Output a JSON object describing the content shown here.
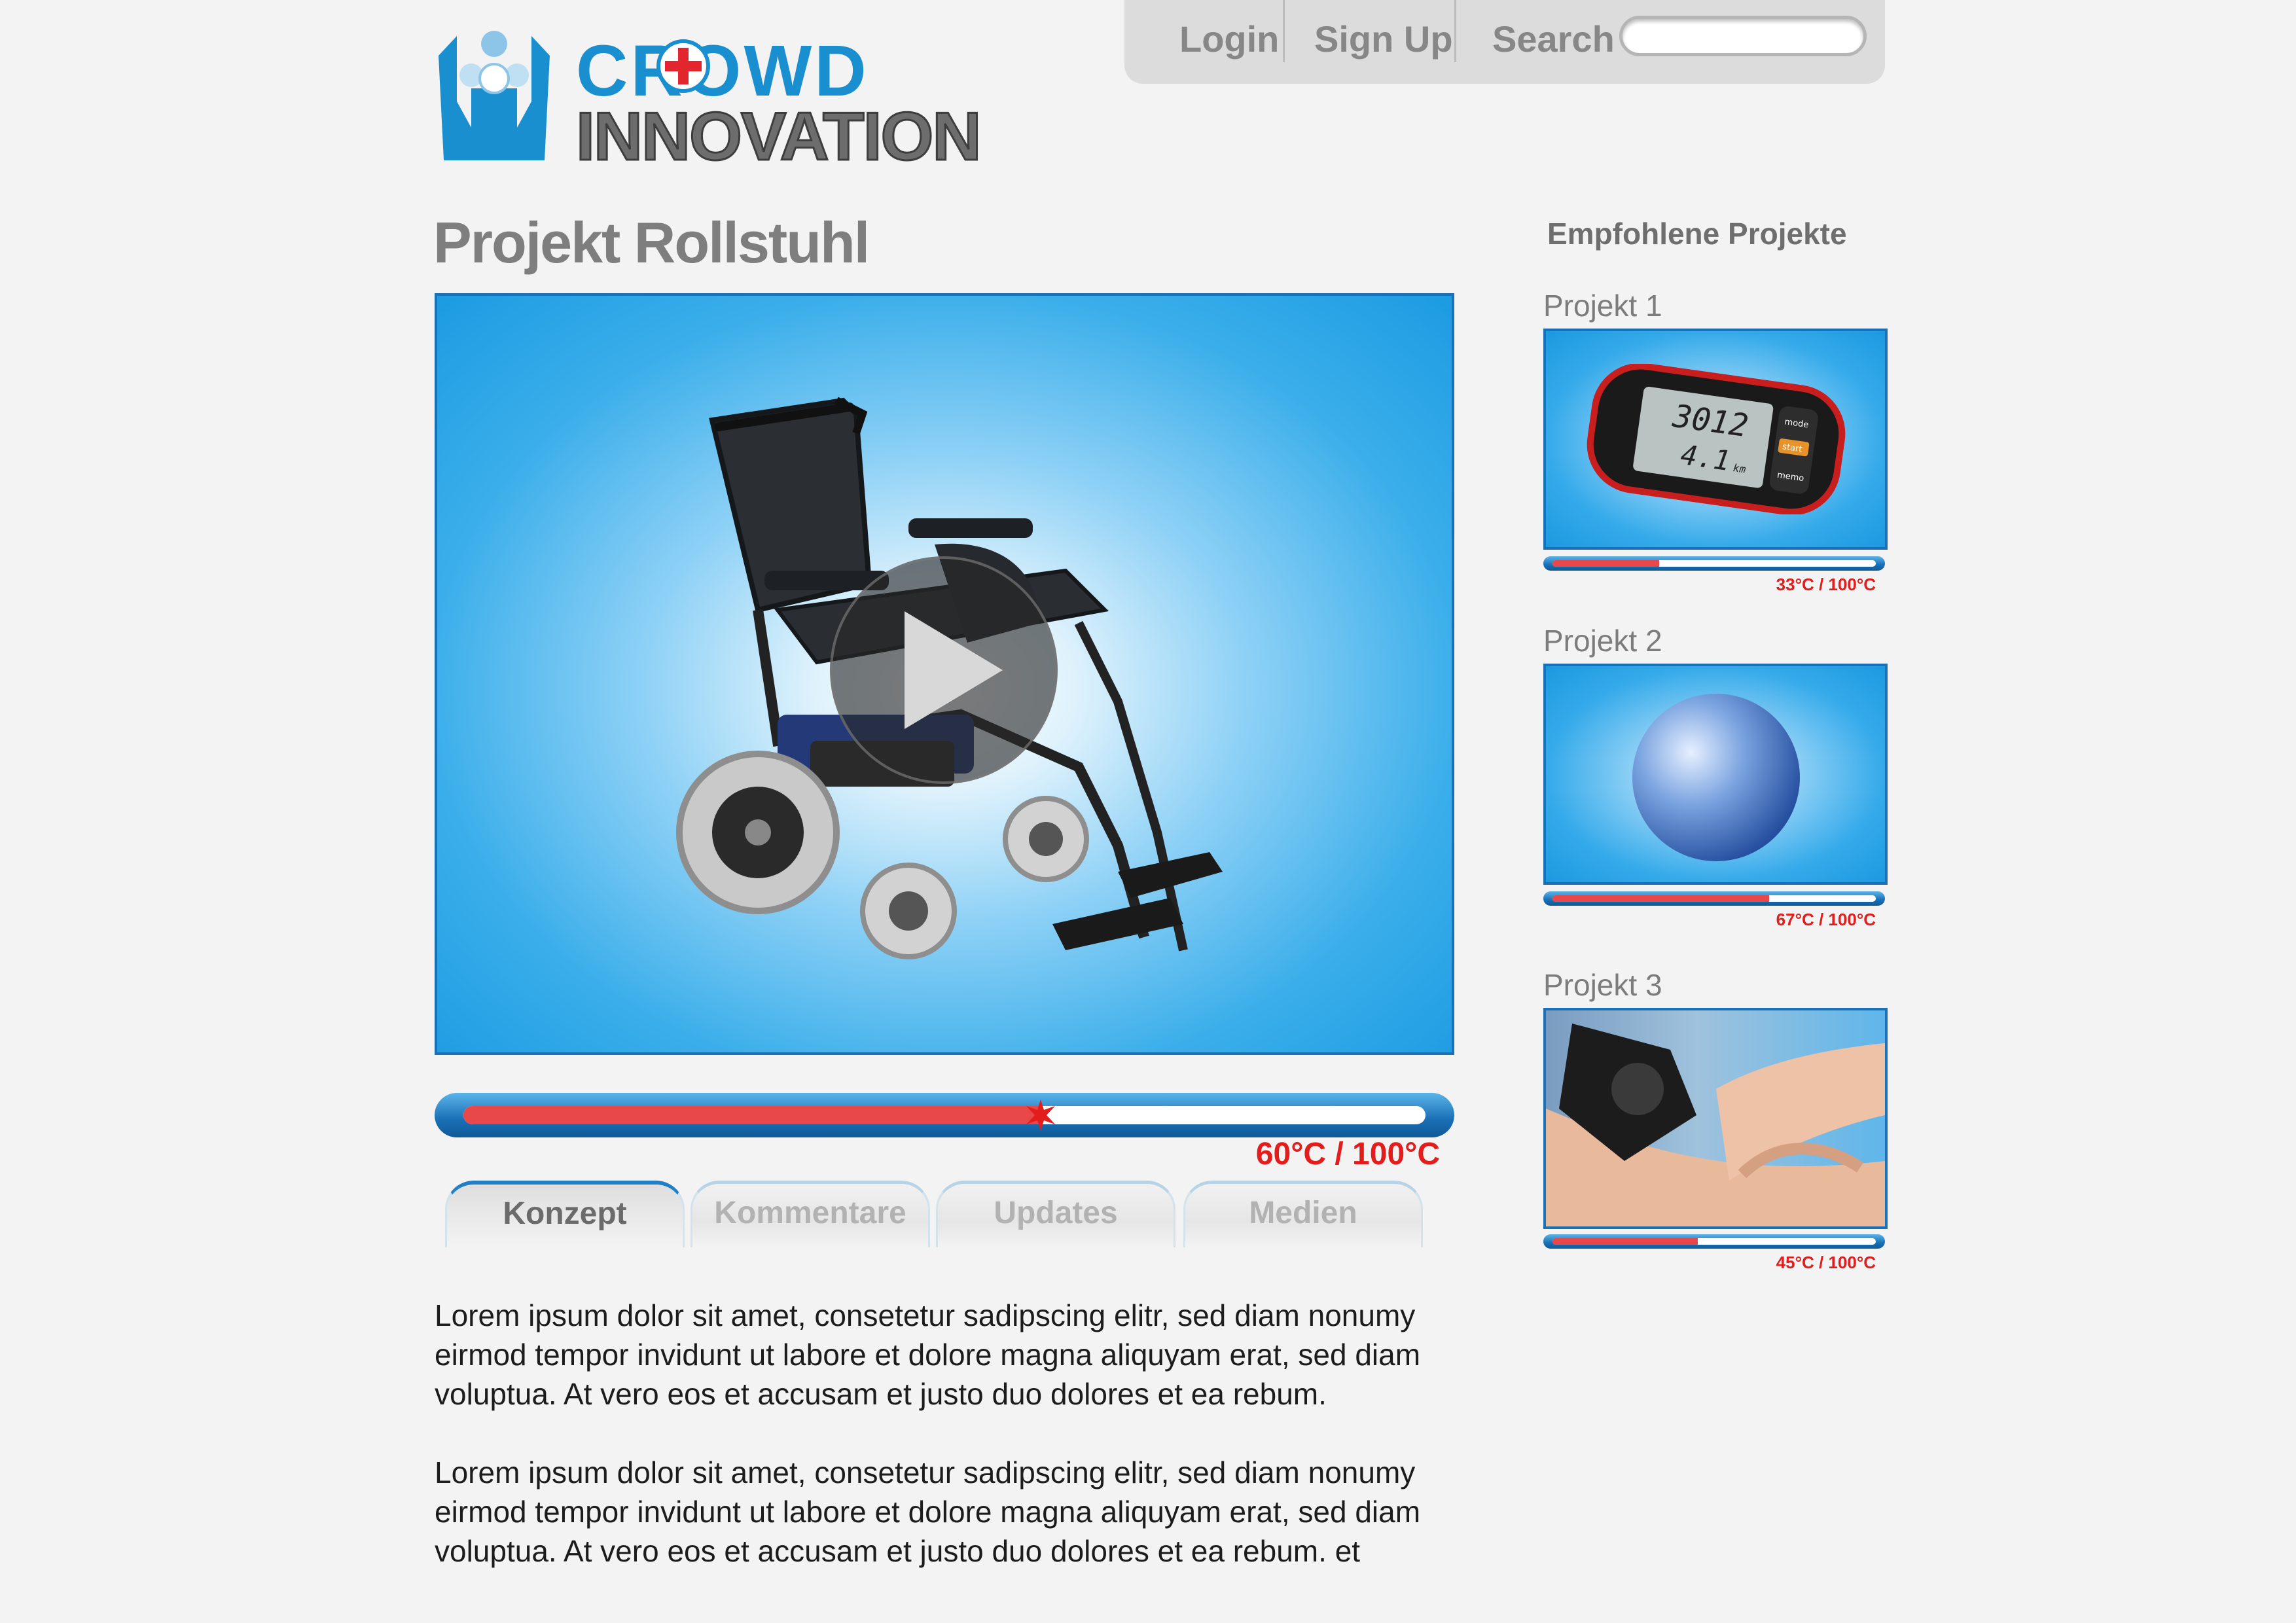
{
  "brand": {
    "line1": "CROWD",
    "line2": "INNOVATION"
  },
  "nav": {
    "login": "Login",
    "signup": "Sign Up",
    "search_label": "Search",
    "search_value": ""
  },
  "page": {
    "title": "Projekt Rollstuhl"
  },
  "main_project": {
    "progress": 0.6,
    "temp_label": "60°C / 100°C"
  },
  "tabs": [
    {
      "label": "Konzept",
      "active": true
    },
    {
      "label": "Kommentare",
      "active": false
    },
    {
      "label": "Updates",
      "active": false
    },
    {
      "label": "Medien",
      "active": false
    }
  ],
  "content": {
    "paragraph1": "Lorem ipsum dolor sit amet, consetetur sadipscing elitr, sed diam nonumy eirmod tempor invidunt ut labore et dolore magna aliquyam erat, sed diam voluptua. At vero eos et accusam et justo duo dolores et ea rebum.",
    "paragraph2": "Lorem ipsum dolor sit amet, consetetur sadipscing elitr, sed diam nonumy eirmod tempor invidunt ut labore et dolore magna aliquyam erat, sed diam voluptua. At vero eos et accusam et justo duo dolores et ea rebum. et"
  },
  "sidebar": {
    "title": "Empfohlene Projekte",
    "projects": [
      {
        "label": "Projekt 1",
        "progress": 0.33,
        "temp_label": "33°C / 100°C",
        "image": "pedometer",
        "display_top": "3012",
        "display_bottom": "4.1",
        "display_unit": "km",
        "btn_mode": "mode",
        "btn_start": "start",
        "btn_memo": "memo"
      },
      {
        "label": "Projekt 2",
        "progress": 0.67,
        "temp_label": "67°C / 100°C",
        "image": "exercise-ball"
      },
      {
        "label": "Projekt 3",
        "progress": 0.45,
        "temp_label": "45°C / 100°C",
        "image": "knee-brace"
      }
    ]
  },
  "colors": {
    "accent_blue": "#1b71b8",
    "progress_red": "#e8484a",
    "temp_red": "#e31c1c"
  }
}
